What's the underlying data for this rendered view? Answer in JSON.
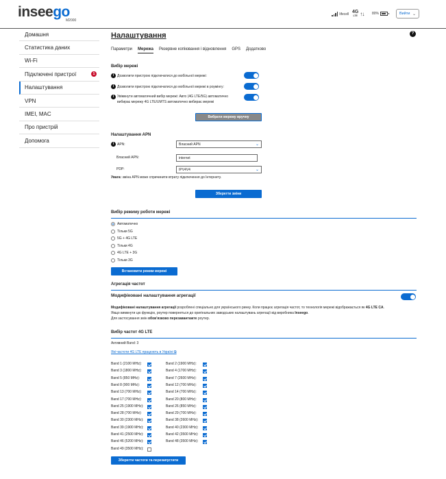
{
  "header": {
    "logo_main": "insee",
    "logo_accent": "go",
    "model": "M2000",
    "carrier": "lifecell",
    "network": "4G",
    "network_sub": "LTE",
    "battery": "80%",
    "logout": "Вийти"
  },
  "sidebar": {
    "items": [
      {
        "label": "Домашня"
      },
      {
        "label": "Статистика даних"
      },
      {
        "label": "Wi-Fi"
      },
      {
        "label": "Підключені пристрої",
        "badge": "1"
      },
      {
        "label": "Налаштування"
      },
      {
        "label": "VPN"
      },
      {
        "label": "IMEI, MAC"
      },
      {
        "label": "Про пристрій"
      },
      {
        "label": "Допомога"
      }
    ]
  },
  "main": {
    "title": "Налаштування",
    "tabs": [
      "Параметри",
      "Мережа",
      "Резервне копіювання і відновлення",
      "GPS",
      "Додатково"
    ],
    "network_select": {
      "heading": "Вибір мережі",
      "opt1": "Дозволити пристрою підключатися до мобільної мережі:",
      "opt2": "Дозволити пристрою підключатися до мобільної мережі в роумінгу:",
      "opt3a": "Увімкнути автоматичний вибір мережі: Авто (4G LTE/5G) автоматично",
      "opt3b": "вибирає мережу 4G LTE/UMTS автоматично вибирає мережі",
      "manual_btn": "Вибрати мережу вручну"
    },
    "apn": {
      "heading": "Налаштування APN",
      "apn_label": "APN:",
      "apn_value": "Власний APN",
      "own_label": "Власний APN:",
      "own_value": "internet",
      "pdp_label": "PDP:",
      "pdp_value": "IPV4V4",
      "warn_bold": "Увага:",
      "warn_text": " зміна APN може спричинити втрату підключення до Інтернету.",
      "save_btn": "Зберегти зміни"
    },
    "mode": {
      "heading": "Вибір режиму роботи мережі",
      "options": [
        "Автоматично",
        "Тільки 5G",
        "5G + 4G LTE",
        "Тільки 4G",
        "4G LTE + 3G",
        "Тільки 3G"
      ],
      "set_btn": "Встановити режим мережі"
    },
    "ca": {
      "heading": "Агрегація частот",
      "sub": "Модифіковані налаштування агрегації",
      "n1_bold": "Модифіковані налаштування агрегації",
      "n1_text": " розроблені спеціально для українського ринку. Коли працює агрегація частот, то технологія мережі відображається як ",
      "n1_bold2": "4G LTE CA",
      "n1_end": ".",
      "n2_text": "Якщо вимкнути цю функцію, роутер повернеться до оригінальних заводських налаштувань агрегації від виробника ",
      "n2_bold": "Inseego",
      "n2_end": ".",
      "n3_text": "Для застосування змін ",
      "n3_bold": "обов'язково перезавантажте",
      "n3_end": " роутер."
    },
    "bands": {
      "heading": "Вибір частот 4G LTE",
      "active": "Активний Band: 3",
      "link": "Які частоти 4G LTE працюють в Україні",
      "left": [
        {
          "label": "Band 1 (2100 MHz):",
          "on": true
        },
        {
          "label": "Band 3 (1800 MHz):",
          "on": true
        },
        {
          "label": "Band 5 (850 MHz):",
          "on": true
        },
        {
          "label": "Band 8 (900 MHz):",
          "on": true
        },
        {
          "label": "Band 13 (700 MHz):",
          "on": true
        },
        {
          "label": "Band 17 (700 MHz):",
          "on": true
        },
        {
          "label": "Band 25 (1900 MHz):",
          "on": true
        },
        {
          "label": "Band 28 (700 MHz):",
          "on": true
        },
        {
          "label": "Band 30 (2300 MHz):",
          "on": true
        },
        {
          "label": "Band 39 (1900 MHz):",
          "on": true
        },
        {
          "label": "Band 41 (2500 MHz):",
          "on": true
        },
        {
          "label": "Band 46 (5200 MHz):",
          "on": true
        },
        {
          "label": "Band 49 (3500 MHz):",
          "on": false
        }
      ],
      "right": [
        {
          "label": "Band 2 (1900 MHz):",
          "on": true
        },
        {
          "label": "Band 4 (1700 MHz):",
          "on": true
        },
        {
          "label": "Band 7 (2600 MHz):",
          "on": true
        },
        {
          "label": "Band 12 (700 MHz):",
          "on": true
        },
        {
          "label": "Band 14 (700 MHz):",
          "on": true
        },
        {
          "label": "Band 20 (800 MHz):",
          "on": true
        },
        {
          "label": "Band 26 (850 MHz):",
          "on": true
        },
        {
          "label": "Band 29 (700 MHz):",
          "on": true
        },
        {
          "label": "Band 38 (2600 MHz):",
          "on": true
        },
        {
          "label": "Band 40 (2300 MHz):",
          "on": true
        },
        {
          "label": "Band 42 (3500 MHz):",
          "on": true
        },
        {
          "label": "Band 48 (3500 MHz):",
          "on": true
        }
      ],
      "save_btn": "Зберегти частоти та перезапустити"
    }
  },
  "colors": {
    "accent": "#0a6bd1",
    "badge": "#c8102e"
  }
}
